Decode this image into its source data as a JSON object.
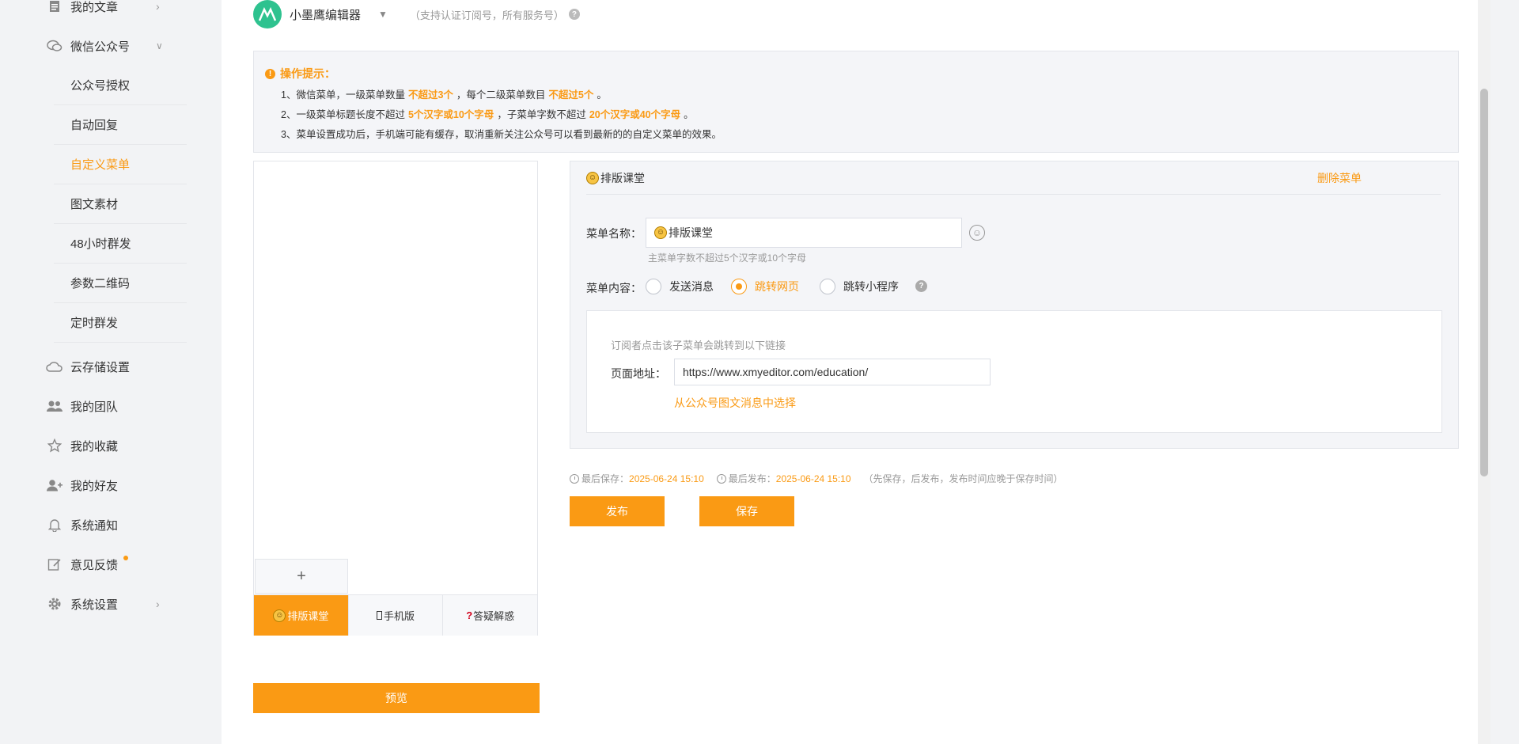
{
  "sidebar": {
    "items": [
      {
        "label": "我的文章",
        "icon": "document-icon"
      },
      {
        "label": "微信公众号",
        "icon": "chat-icon"
      },
      {
        "label": "云存储设置",
        "icon": "cloud-icon"
      },
      {
        "label": "我的团队",
        "icon": "team-icon"
      },
      {
        "label": "我的收藏",
        "icon": "star-icon"
      },
      {
        "label": "我的好友",
        "icon": "add-user-icon"
      },
      {
        "label": "系统通知",
        "icon": "bell-icon"
      },
      {
        "label": "意见反馈",
        "icon": "edit-icon"
      },
      {
        "label": "系统设置",
        "icon": "gear-icon"
      }
    ],
    "wechat_sub": [
      {
        "label": "公众号授权"
      },
      {
        "label": "自动回复"
      },
      {
        "label": "自定义菜单"
      },
      {
        "label": "图文素材"
      },
      {
        "label": "48小时群发"
      },
      {
        "label": "参数二维码"
      },
      {
        "label": "定时群发"
      }
    ]
  },
  "account": {
    "name": "小墨鹰编辑器",
    "note": "（支持认证订阅号，所有服务号）"
  },
  "tips": {
    "title": "操作提示：",
    "line1_a": "1、微信菜单，一级菜单数量",
    "line1_h1": "不超过3个",
    "line1_b": "，每个二级菜单数目",
    "line1_h2": "不超过5个",
    "line1_c": "。",
    "line2_a": "2、一级菜单标题长度不超过",
    "line2_h1": "5个汉字或10个字母",
    "line2_b": "，子菜单字数不超过",
    "line2_h2": "20个汉字或40个字母",
    "line2_c": "。",
    "line3": "3、菜单设置成功后，手机端可能有缓存，取消重新关注公众号可以看到最新的的自定义菜单的效果。"
  },
  "phone": {
    "add": "+",
    "tabs": [
      "排版课堂",
      "手机版",
      "答疑解惑"
    ]
  },
  "preview_label": "预览",
  "editor": {
    "header_name": "排版课堂",
    "delete_label": "删除菜单",
    "name_label": "菜单名称：",
    "name_value": "排版课堂",
    "name_hint": "主菜单字数不超过5个汉字或10个字母",
    "content_label": "菜单内容：",
    "radio_options": [
      "发送消息",
      "跳转网页",
      "跳转小程序"
    ],
    "link_desc": "订阅者点击该子菜单会跳转到以下链接",
    "page_url_label": "页面地址：",
    "page_url": "https://www.xmyeditor.com/education/",
    "pick_from_message": "从公众号图文消息中选择"
  },
  "save_info": {
    "last_saved_label": "最后保存：",
    "last_saved": "2025-06-24 15:10",
    "last_published_label": "最后发布：",
    "last_published": "2025-06-24 15:10",
    "note": "（先保存，后发布，发布时间应晚于保存时间）"
  },
  "buttons": {
    "publish": "发布",
    "save": "保存"
  },
  "colors": {
    "accent": "#fa9a14",
    "avatar": "#2ec28f"
  }
}
